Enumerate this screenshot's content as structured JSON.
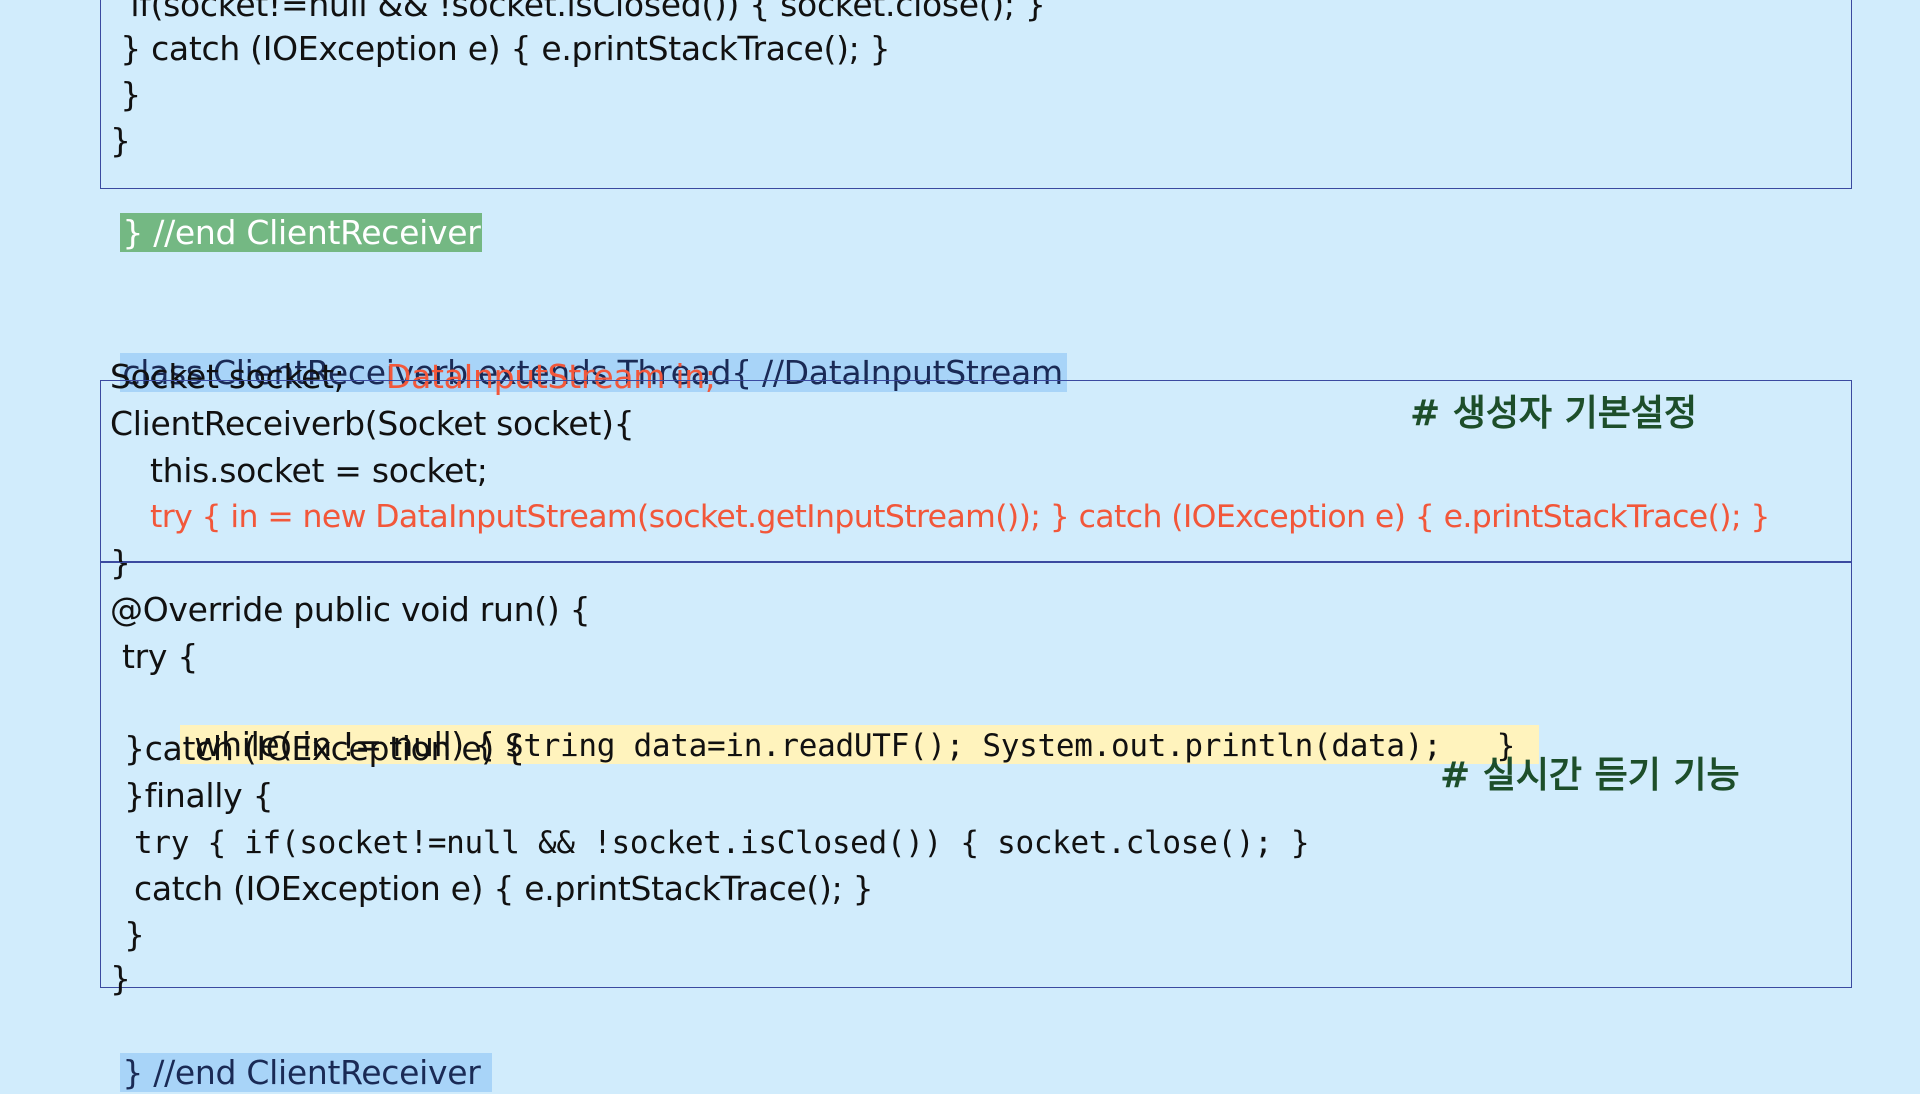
{
  "top_block": {
    "lines": [
      "  if(socket!=null && !socket.isClosed()) { socket.close(); }",
      " } catch (IOException e) { e.printStackTrace(); }",
      " }",
      "}"
    ],
    "end_marker": "} //end ClientReceiver"
  },
  "class_block": {
    "header": "class ClientReceiverb extends Thread{ //DataInputStream",
    "field_socket": "Socket socket;",
    "field_in": "DataInputStream in;",
    "constructor": {
      "signature": "ClientReceiverb(Socket socket){",
      "assign": "this.socket = socket;",
      "try_line": "try { in = new DataInputStream(socket.getInputStream()); } catch (IOException e) { e.printStackTrace(); }",
      "close": "}",
      "note": "# 생성자 기본설정"
    },
    "run": {
      "signature": "@Override public void run() {",
      "try_open": "try {",
      "while_kw": "while( in != null) { ",
      "while_body": "String data=in.readUTF(); System.out.println(data);   }",
      "catch_line": "}catch (IOException e) {",
      "finally_line": "}finally {",
      "inner_try": "try { if(socket!=null && !socket.isClosed()) { socket.close(); }",
      "inner_catch": "catch (IOException e) { e.printStackTrace(); }",
      "close1": "}",
      "close2": "}",
      "note": "# 실시간 듣기 기능"
    },
    "end_marker": "} //end ClientReceiver"
  },
  "colors": {
    "background": "#d1ecfc",
    "box_border": "#3b4aa0",
    "red_code": "#f2573a",
    "note_green": "#1d4e2a",
    "highlight_green": "#74b883",
    "highlight_blue": "#a8d4f8",
    "highlight_yellow": "#fff3bd"
  }
}
